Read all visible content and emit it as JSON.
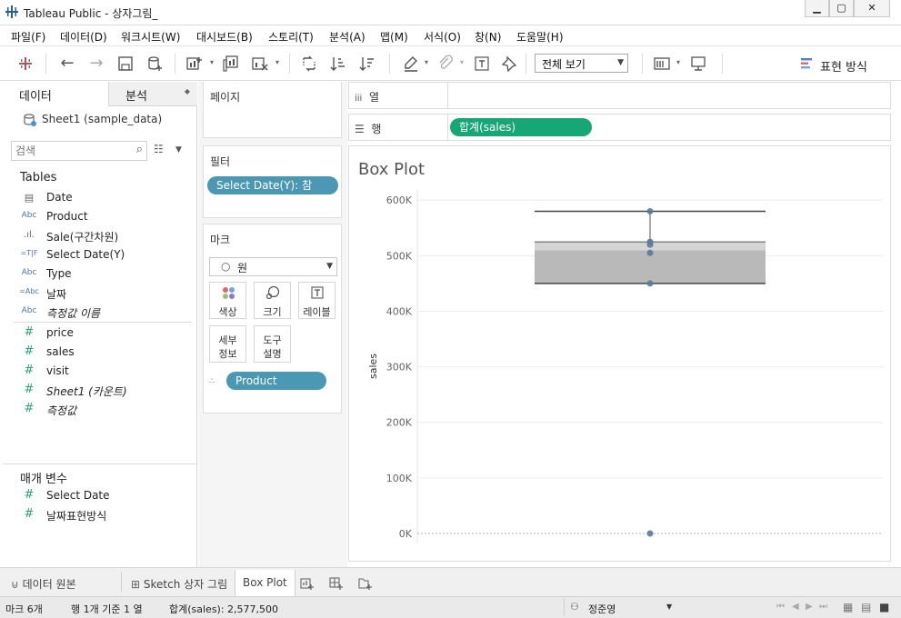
{
  "window": {
    "title": "Tableau Public - 상자그림_",
    "controls": [
      "minimize-icon",
      "maximize-icon",
      "close-icon"
    ]
  },
  "menu": [
    "파일(F)",
    "데이터(D)",
    "워크시트(W)",
    "대시보드(B)",
    "스토리(T)",
    "분석(A)",
    "맵(M)",
    "서식(O)",
    "창(N)",
    "도움말(H)"
  ],
  "toolbar": {
    "view_select": "전체 보기",
    "show_me": "표현 방식"
  },
  "data_pane": {
    "tab_data": "데이터",
    "tab_analysis": "분석",
    "datasource": "Sheet1 (sample_data)",
    "search_placeholder": "검색",
    "tables_header": "Tables",
    "dimensions": [
      {
        "icon": "calendar-icon",
        "label": "Date",
        "italic": false
      },
      {
        "icon": "Abc",
        "label": "Product",
        "italic": false
      },
      {
        "icon": "bin-icon",
        "label": "Sale(구간차원)",
        "italic": false
      },
      {
        "icon": "=T|F",
        "label": "Select Date(Y)",
        "italic": false
      },
      {
        "icon": "Abc",
        "label": "Type",
        "italic": false
      },
      {
        "icon": "=Abc",
        "label": "날짜",
        "italic": false
      },
      {
        "icon": "Abc",
        "label": "측정값 이름",
        "italic": true
      }
    ],
    "measures": [
      {
        "icon": "#",
        "label": "price",
        "italic": false
      },
      {
        "icon": "#",
        "label": "sales",
        "italic": false
      },
      {
        "icon": "#",
        "label": "visit",
        "italic": false
      },
      {
        "icon": "#",
        "label": "Sheet1 (카운트)",
        "italic": true
      },
      {
        "icon": "#",
        "label": "측정값",
        "italic": true
      }
    ],
    "parameters_header": "매개 변수",
    "parameters": [
      {
        "icon": "#",
        "label": "Select Date"
      },
      {
        "icon": "#",
        "label": "날짜표현방식"
      }
    ]
  },
  "cards": {
    "pages_title": "페이지",
    "filters_title": "필터",
    "filter_pill": "Select Date(Y): 참",
    "marks_title": "마크",
    "mark_type": "원",
    "mark_buttons": {
      "color": "색상",
      "size": "크기",
      "label": "레이블",
      "detail": [
        "세부",
        "정보"
      ],
      "tooltip": [
        "도구",
        "설명"
      ]
    },
    "detail_pill": "Product"
  },
  "shelves": {
    "columns_label": "열",
    "rows_label": "행",
    "rows_pill": "합계(sales)"
  },
  "colors": {
    "measure_pill": "#17a776",
    "dimension_pill": "#4b98b5",
    "mark_dot": "#5b7a99",
    "box_fill": "#b9b9b9"
  },
  "chart_data": {
    "type": "box",
    "title": "Box Plot",
    "ylabel": "sales",
    "xlabel": "",
    "ylim": [
      0,
      620000
    ],
    "ytick_labels": [
      "0K",
      "100K",
      "200K",
      "300K",
      "400K",
      "500K",
      "600K"
    ],
    "ytick_values": [
      0,
      100000,
      200000,
      300000,
      400000,
      500000,
      600000
    ],
    "grid": true,
    "box": {
      "whisker_min": 450000,
      "q1": 450000,
      "median": 510000,
      "q3": 525000,
      "whisker_max": 580000
    },
    "points": [
      0,
      450000,
      505000,
      520000,
      525000,
      580000
    ]
  },
  "tabs": {
    "datasource": "데이터 원본",
    "sheet1": "Sketch 상자 그림",
    "sheet2": "Box Plot",
    "new_sheet": "new-worksheet-icon",
    "new_dashboard": "new-dashboard-icon",
    "new_story": "new-story-icon"
  },
  "status": {
    "marks": "마크 6개",
    "rows_cols": "행 1개 기준 1 열",
    "sum": "합계(sales): 2,577,500",
    "user": "정준영"
  }
}
